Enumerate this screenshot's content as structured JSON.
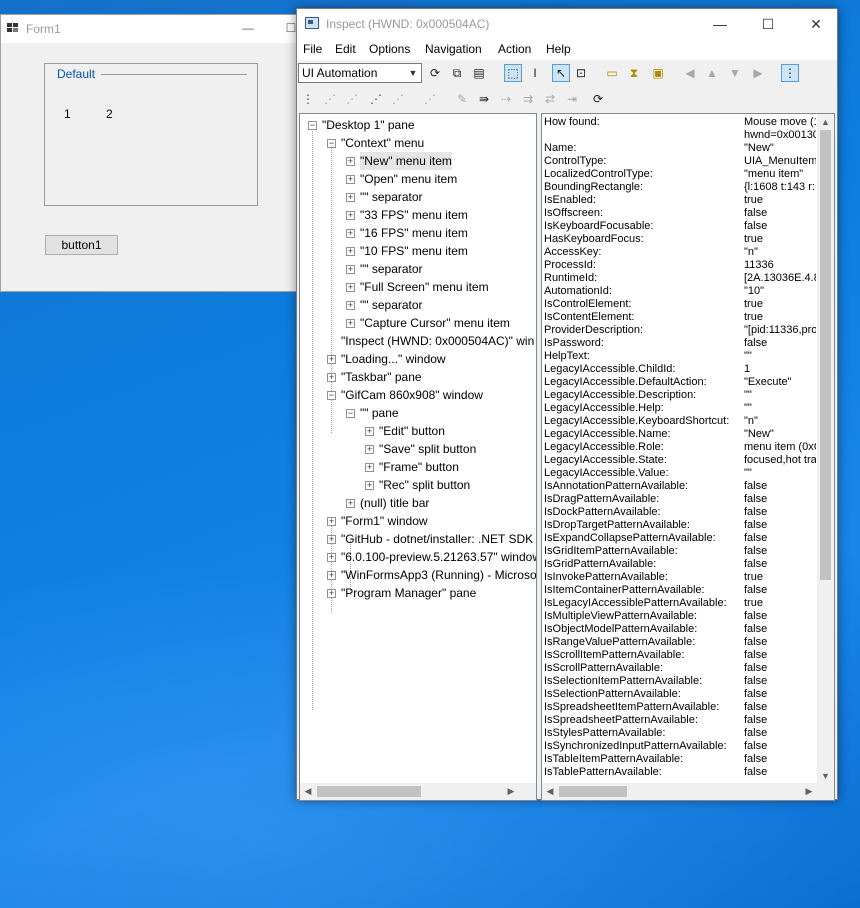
{
  "form1": {
    "title": "Form1",
    "groupbox_label": "Default",
    "value1": "1",
    "value2": "2",
    "button_label": "button1"
  },
  "inspect": {
    "title": "Inspect  (HWND: 0x000504AC)",
    "menu": [
      "File",
      "Edit",
      "Options",
      "Navigation",
      "Action",
      "Help"
    ],
    "mode": "UI Automation",
    "tree": [
      {
        "label": "\"Desktop 1\" pane",
        "level": 0,
        "exp": "−"
      },
      {
        "label": "\"Context\" menu",
        "level": 1,
        "exp": "−"
      },
      {
        "label": "\"New\" menu item",
        "level": 2,
        "exp": "+",
        "selected": true
      },
      {
        "label": "\"Open\" menu item",
        "level": 2,
        "exp": "+"
      },
      {
        "label": "\"\" separator",
        "level": 2,
        "exp": "+"
      },
      {
        "label": "\"33 FPS\" menu item",
        "level": 2,
        "exp": "+"
      },
      {
        "label": "\"16 FPS\" menu item",
        "level": 2,
        "exp": "+"
      },
      {
        "label": "\"10 FPS\" menu item",
        "level": 2,
        "exp": "+"
      },
      {
        "label": "\"\" separator",
        "level": 2,
        "exp": "+"
      },
      {
        "label": "\"Full Screen\" menu item",
        "level": 2,
        "exp": "+"
      },
      {
        "label": "\"\" separator",
        "level": 2,
        "exp": "+"
      },
      {
        "label": "\"Capture Cursor\" menu item",
        "level": 2,
        "exp": "+"
      },
      {
        "label": "\"Inspect  (HWND: 0x000504AC)\" win",
        "level": 1,
        "exp": ""
      },
      {
        "label": "\"Loading...\" window",
        "level": 1,
        "exp": "+"
      },
      {
        "label": "\"Taskbar\" pane",
        "level": 1,
        "exp": "+"
      },
      {
        "label": "\"GifCam 860x908\" window",
        "level": 1,
        "exp": "−"
      },
      {
        "label": "\"\" pane",
        "level": 2,
        "exp": "−"
      },
      {
        "label": "\"Edit\" button",
        "level": 3,
        "exp": "+"
      },
      {
        "label": "\"Save\" split button",
        "level": 3,
        "exp": "+"
      },
      {
        "label": "\"Frame\" button",
        "level": 3,
        "exp": "+"
      },
      {
        "label": "\"Rec\" split button",
        "level": 3,
        "exp": "+"
      },
      {
        "label": "(null) title bar",
        "level": 2,
        "exp": "+"
      },
      {
        "label": "\"Form1\" window",
        "level": 1,
        "exp": "+"
      },
      {
        "label": "\"GitHub - dotnet/installer: .NET SDK",
        "level": 1,
        "exp": "+"
      },
      {
        "label": "\"6.0.100-preview.5.21263.57\" window",
        "level": 1,
        "exp": "+"
      },
      {
        "label": "\"WinFormsApp3 (Running) - Microso",
        "level": 1,
        "exp": "+"
      },
      {
        "label": "\"Program Manager\" pane",
        "level": 1,
        "exp": "+"
      }
    ],
    "properties": [
      {
        "k": "How found:",
        "v": "Mouse move (1"
      },
      {
        "k": "",
        "v": "hwnd=0x00130"
      },
      {
        "k": "Name:",
        "v": "\"New\""
      },
      {
        "k": "ControlType:",
        "v": "UIA_MenuItem"
      },
      {
        "k": "LocalizedControlType:",
        "v": "\"menu item\""
      },
      {
        "k": "BoundingRectangle:",
        "v": "{l:1608 t:143 r:"
      },
      {
        "k": "IsEnabled:",
        "v": "true"
      },
      {
        "k": "IsOffscreen:",
        "v": "false"
      },
      {
        "k": "IsKeyboardFocusable:",
        "v": "false"
      },
      {
        "k": "HasKeyboardFocus:",
        "v": "true"
      },
      {
        "k": "AccessKey:",
        "v": "\"n\""
      },
      {
        "k": "ProcessId:",
        "v": "11336"
      },
      {
        "k": "RuntimeId:",
        "v": "[2A.13036E.4.8"
      },
      {
        "k": "AutomationId:",
        "v": "\"10\""
      },
      {
        "k": "IsControlElement:",
        "v": "true"
      },
      {
        "k": "IsContentElement:",
        "v": "true"
      },
      {
        "k": "ProviderDescription:",
        "v": "\"[pid:11336,pro"
      },
      {
        "k": "IsPassword:",
        "v": "false"
      },
      {
        "k": "HelpText:",
        "v": "\"\""
      },
      {
        "k": "LegacyIAccessible.ChildId:",
        "v": "1"
      },
      {
        "k": "LegacyIAccessible.DefaultAction:",
        "v": "\"Execute\""
      },
      {
        "k": "LegacyIAccessible.Description:",
        "v": "\"\""
      },
      {
        "k": "LegacyIAccessible.Help:",
        "v": "\"\""
      },
      {
        "k": "LegacyIAccessible.KeyboardShortcut:",
        "v": "\"n\""
      },
      {
        "k": "LegacyIAccessible.Name:",
        "v": "\"New\""
      },
      {
        "k": "LegacyIAccessible.Role:",
        "v": "menu item (0xC"
      },
      {
        "k": "LegacyIAccessible.State:",
        "v": "focused,hot tra"
      },
      {
        "k": "LegacyIAccessible.Value:",
        "v": "\"\""
      },
      {
        "k": "IsAnnotationPatternAvailable:",
        "v": "false"
      },
      {
        "k": "IsDragPatternAvailable:",
        "v": "false"
      },
      {
        "k": "IsDockPatternAvailable:",
        "v": "false"
      },
      {
        "k": "IsDropTargetPatternAvailable:",
        "v": "false"
      },
      {
        "k": "IsExpandCollapsePatternAvailable:",
        "v": "false"
      },
      {
        "k": "IsGridItemPatternAvailable:",
        "v": "false"
      },
      {
        "k": "IsGridPatternAvailable:",
        "v": "false"
      },
      {
        "k": "IsInvokePatternAvailable:",
        "v": "true"
      },
      {
        "k": "IsItemContainerPatternAvailable:",
        "v": "false"
      },
      {
        "k": "IsLegacyIAccessiblePatternAvailable:",
        "v": "true"
      },
      {
        "k": "IsMultipleViewPatternAvailable:",
        "v": "false"
      },
      {
        "k": "IsObjectModelPatternAvailable:",
        "v": "false"
      },
      {
        "k": "IsRangeValuePatternAvailable:",
        "v": "false"
      },
      {
        "k": "IsScrollItemPatternAvailable:",
        "v": "false"
      },
      {
        "k": "IsScrollPatternAvailable:",
        "v": "false"
      },
      {
        "k": "IsSelectionItemPatternAvailable:",
        "v": "false"
      },
      {
        "k": "IsSelectionPatternAvailable:",
        "v": "false"
      },
      {
        "k": "IsSpreadsheetItemPatternAvailable:",
        "v": "false"
      },
      {
        "k": "IsSpreadsheetPatternAvailable:",
        "v": "false"
      },
      {
        "k": "IsStylesPatternAvailable:",
        "v": "false"
      },
      {
        "k": "IsSynchronizedInputPatternAvailable:",
        "v": "false"
      },
      {
        "k": "IsTableItemPatternAvailable:",
        "v": "false"
      },
      {
        "k": "IsTablePatternAvailable:",
        "v": "false"
      }
    ]
  }
}
